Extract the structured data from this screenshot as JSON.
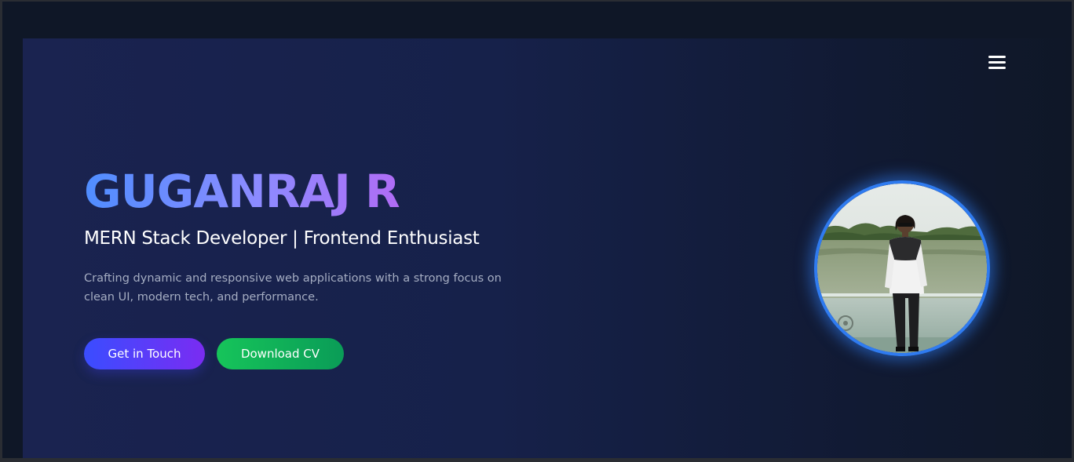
{
  "nav": {
    "menu_icon": "hamburger-menu-icon"
  },
  "hero": {
    "name": "GUGANRAJ R",
    "role": "MERN Stack Developer | Frontend Enthusiast",
    "description": "Crafting dynamic and responsive web applications with a strong focus on clean UI, modern tech, and performance.",
    "buttons": {
      "get_in_touch": "Get in Touch",
      "download_cv": "Download CV"
    }
  },
  "profile": {
    "image": "profile-photo"
  },
  "colors": {
    "accent_blue": "#4f8dff",
    "accent_purple": "#b06cf5",
    "cta_primary": "#3a4dff",
    "cta_secondary": "#16c45a",
    "ring": "#2f7bf0",
    "background": "#0f1727"
  }
}
